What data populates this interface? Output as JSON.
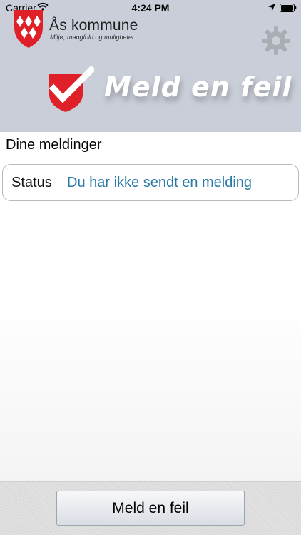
{
  "status_bar": {
    "carrier": "Carrier",
    "time": "4:24 PM"
  },
  "header": {
    "municipality_name": "Ås kommune",
    "municipality_tagline": "Miljø, mangfold og muligheter",
    "app_title": "Meld en feil",
    "settings_icon": "gear-icon"
  },
  "main": {
    "section_title": "Dine meldinger",
    "status_card": {
      "label": "Status",
      "value": "Du har ikke sendt en melding"
    }
  },
  "bottom_bar": {
    "report_button_label": "Meld en feil"
  },
  "colors": {
    "header_bg": "#c9ced8",
    "status_value": "#2a7aa8",
    "brand_red": "#e02029"
  }
}
